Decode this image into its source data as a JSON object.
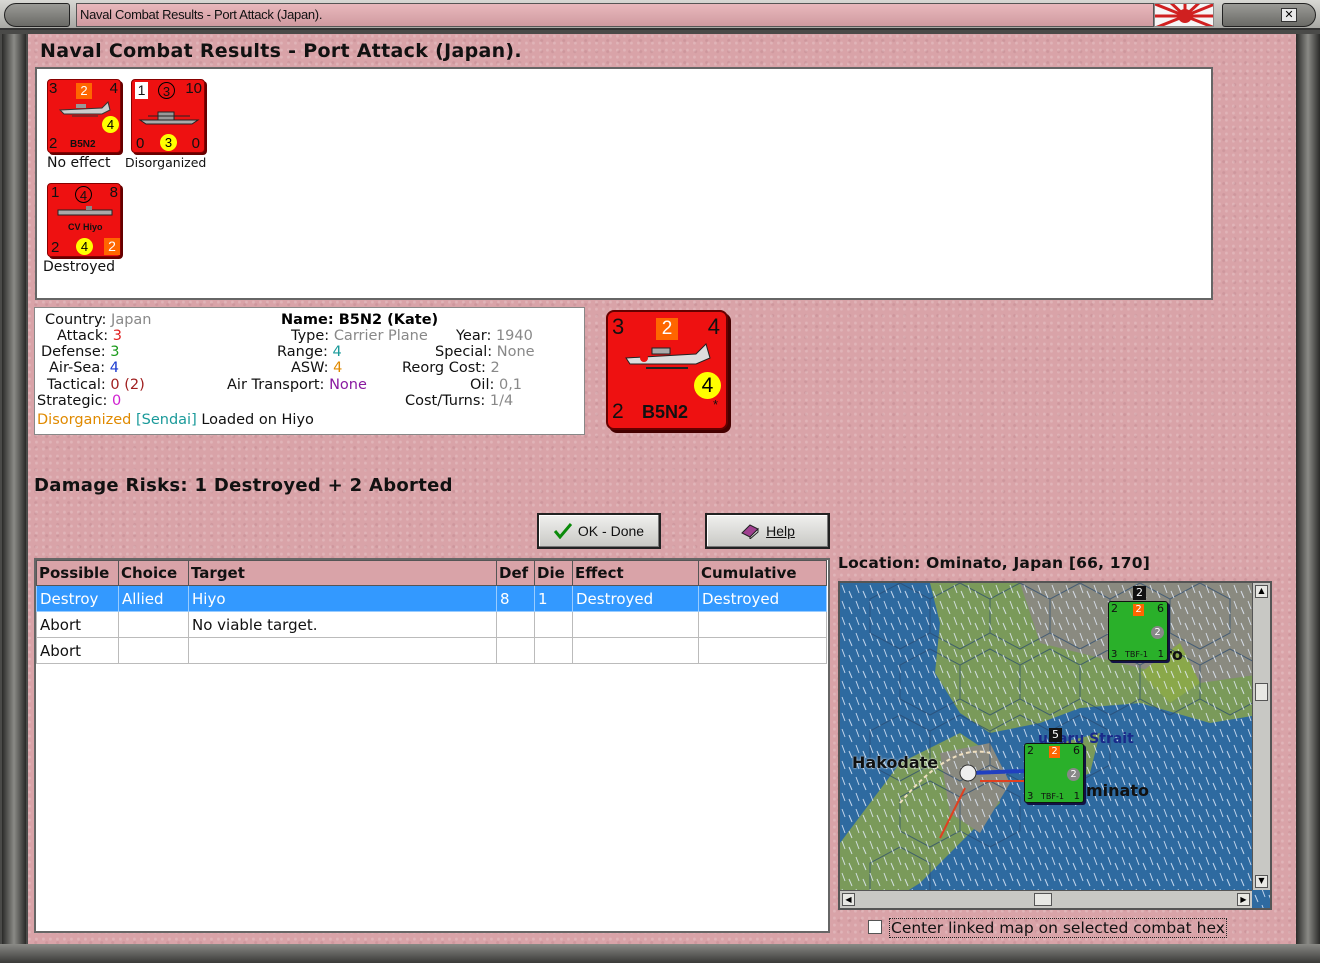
{
  "window": {
    "title": "Naval Combat Results - Port Attack (Japan)."
  },
  "header": {
    "title": "Naval Combat Results - Port Attack (Japan)."
  },
  "units": [
    {
      "top_left": "3",
      "top_mid": "2",
      "top_right": "4",
      "circle": "4",
      "bottom_left": "2",
      "name": "B5N2",
      "label": "No effect"
    },
    {
      "top_left": "1",
      "top_mid": "3",
      "top_right": "10",
      "circle": "3",
      "bottom_left": "0",
      "bottom_right": "0",
      "label": "Disorganized"
    },
    {
      "top_left": "1",
      "top_mid": "4",
      "top_right": "8",
      "circle": "4",
      "bottom_left": "2",
      "bottom_right": "2",
      "name": "CV Hiyo",
      "label": "Destroyed"
    }
  ],
  "info": {
    "country_k": "Country:",
    "country_v": "Japan",
    "attack_k": "Attack:",
    "attack_v": "3",
    "defense_k": "Defense:",
    "defense_v": "3",
    "airsea_k": "Air-Sea:",
    "airsea_v": "4",
    "tactical_k": "Tactical:",
    "tactical_v1": "0",
    "tactical_v2": "(2)",
    "strategic_k": "Strategic:",
    "strategic_v": "0",
    "name_line": "Name: B5N2 (Kate)",
    "type_k": "Type:",
    "type_v": "Carrier Plane",
    "range_k": "Range:",
    "range_v": "4",
    "asw_k": "ASW:",
    "asw_v": "4",
    "airtrans_k": "Air Transport:",
    "airtrans_v": "None",
    "year_k": "Year:",
    "year_v": "1940",
    "special_k": "Special:",
    "special_v": "None",
    "reorg_k": "Reorg Cost:",
    "reorg_v": "2",
    "oil_k": "Oil:",
    "oil_v": "0,1",
    "cost_k": "Cost/Turns:",
    "cost_v": "1/4",
    "status_a": "Disorganized",
    "status_b": "[Sendai]",
    "status_c": "Loaded on Hiyo"
  },
  "big_counter": {
    "top_left": "3",
    "top_mid": "2",
    "top_right": "4",
    "circle": "4",
    "bottom_left": "2",
    "name": "B5N2",
    "star": "*"
  },
  "damage_risks": "Damage Risks:  1 Destroyed + 2 Aborted",
  "buttons": {
    "ok": "OK - Done",
    "help": "Help"
  },
  "table": {
    "headers": [
      "Possible",
      "Choice",
      "Target",
      "Def",
      "Die",
      "Effect",
      "Cumulative"
    ],
    "rows": [
      [
        "Destroy",
        "Allied",
        "Hiyo",
        "8",
        "1",
        "Destroyed",
        "Destroyed"
      ],
      [
        "Abort",
        "",
        "No viable target.",
        "",
        "",
        "",
        ""
      ],
      [
        "Abort",
        "",
        "",
        "",
        "",
        "",
        ""
      ]
    ]
  },
  "location": "Location:  Ominato, Japan [66, 170]",
  "map": {
    "labels": {
      "hakodate": "Hakodate",
      "strait": "ugaru Strait",
      "ominato": "minato",
      "poro": "ro"
    },
    "counter1": {
      "tl": "2",
      "tm": "2",
      "tr": "6",
      "circle": "2",
      "bl": "3",
      "name": "TBF-1",
      "br": "1",
      "stack": "2"
    },
    "counter2": {
      "tl": "2",
      "tm": "2",
      "tr": "6",
      "circle": "2",
      "bl": "3",
      "name": "TBF-1",
      "br": "1",
      "stack": "5"
    }
  },
  "center_linked": "Center linked map on selected combat hex",
  "colors": {
    "panel": "#d9a3a8",
    "counter_red": "#ee1111",
    "allied_green": "#22bb22",
    "selection": "#3399ff"
  }
}
